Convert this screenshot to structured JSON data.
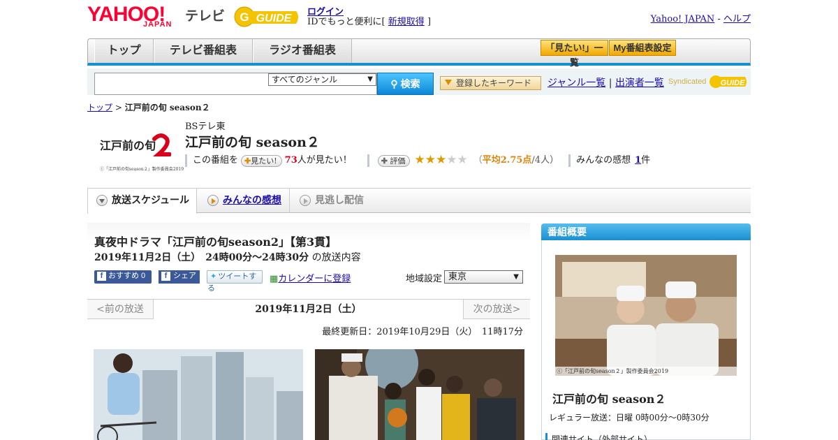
{
  "header": {
    "logo_yahoo": "YAHOO!",
    "logo_japan": "JAPAN",
    "logo_terebi": "テレビ",
    "logo_gguide": "G-GUIDE",
    "login": "ログイン",
    "id_prefix": "IDでもっと便利に[",
    "register": "新規取得",
    "id_suffix": "]",
    "yahoo_japan_link": "Yahoo! JAPAN",
    "sep": "-",
    "help_link": "ヘルプ"
  },
  "nav": {
    "tabs": [
      "トップ",
      "テレビ番組表",
      "ラジオ番組表"
    ],
    "mitai_list": "「見たい!」一覧",
    "my_settings": "My番組表設定"
  },
  "search": {
    "input_value": "",
    "genre_selected": "すべてのジャンル",
    "search_button": "検索",
    "keyword_button": "登録したキーワード",
    "genre_link": "ジャンル一覧",
    "divider": "|",
    "performer_link": "出演者一覧",
    "syndicated": "Syndicated"
  },
  "breadcrumb": {
    "top": "トップ",
    "sep": ">",
    "current": "江戸前の旬 season２"
  },
  "program": {
    "logo_caption": "ⓒ「江戸前の旬season２」製作委員会2019",
    "logo_text": "江戸前の旬",
    "station": "BSテレ東",
    "title": "江戸前の旬 season２",
    "want_prefix": "この番組を",
    "want_button": "見たい!",
    "want_count": "73",
    "want_suffix": "人が見たい！",
    "rate_button": "評価",
    "rating_value": 2.75,
    "rating_open": "（",
    "rating_text": "平均2.75点",
    "rating_count": "/4人）",
    "impressions_label": "みんなの感想",
    "impressions_count": "1",
    "impressions_suffix": "件"
  },
  "tabs": [
    {
      "label": "放送スケジュール",
      "state": "active"
    },
    {
      "label": "みんなの感想",
      "state": "link"
    },
    {
      "label": "見逃し配信",
      "state": "disabled"
    }
  ],
  "episode": {
    "title": "真夜中ドラマ「江戸前の旬season2」【第3貫】",
    "datetime": "2019年11月2日（土）　24時00分～24時30分",
    "datetime_suffix": "の放送内容",
    "recommend": "おすすめ 0",
    "share": "シェア",
    "tweet": "ツイートする",
    "calendar": "カレンダーに登録",
    "region_label": "地域設定",
    "region_value": "東京",
    "prev": "<前の放送",
    "current_date": "2019年11月2日（土）",
    "next": "次の放送>",
    "updated": "最終更新日：2019年10月29日（火）　11時17分"
  },
  "sidebar": {
    "heading": "番組概要",
    "photo_caption": "ⓒ「江戸前の旬season２」製作委員会2019",
    "title": "江戸前の旬 season２",
    "regular": "レギュラー放送：日曜 0時00分～0時30分",
    "related": "関連サイト（外部サイト）"
  },
  "colors": {
    "accent_blue": "#1590d0",
    "yahoo_red": "#ff0033",
    "rating_orange": "#d9860c"
  }
}
